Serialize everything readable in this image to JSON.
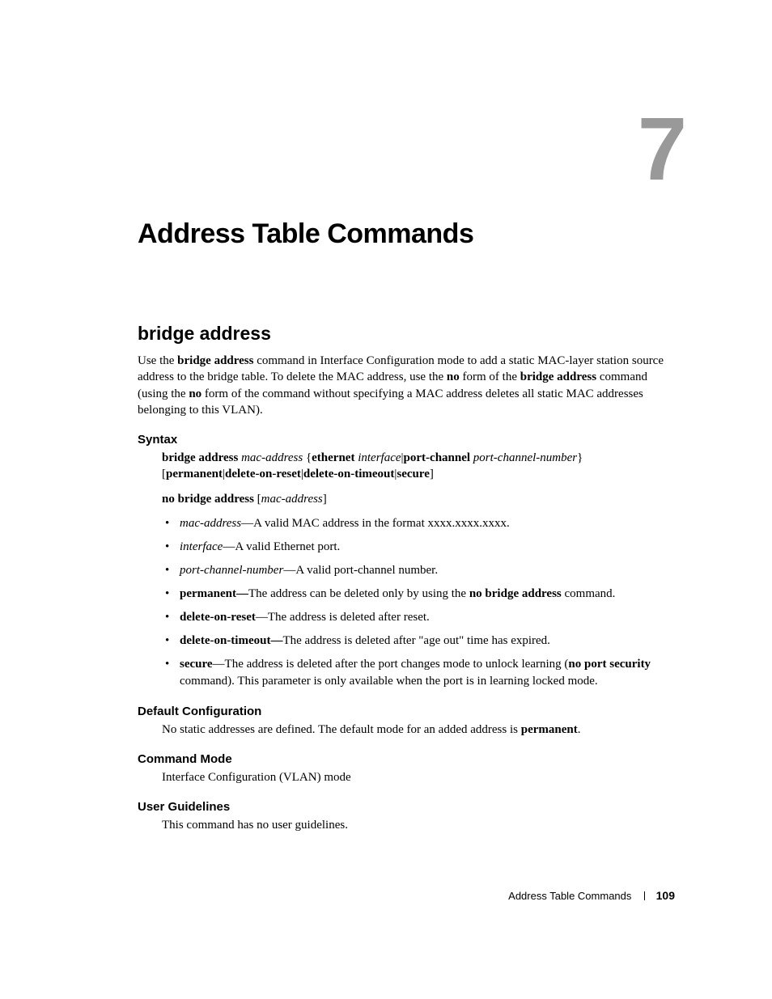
{
  "chapter": {
    "number": "7",
    "title": "Address Table Commands"
  },
  "section": {
    "title": "bridge address",
    "intro_parts": [
      "Use the ",
      "bridge address",
      " command in Interface Configuration mode to add a static MAC-layer station source address to the bridge table. To delete the MAC address, use the ",
      "no",
      " form of the ",
      "bridge address",
      " command (using the ",
      "no",
      " form of the command without specifying a MAC address deletes all static MAC addresses belonging to this VLAN)."
    ]
  },
  "syntax": {
    "heading": "Syntax",
    "line1": {
      "p1": "bridge address ",
      "p2": "mac-address",
      "p3": " {",
      "p4": "ethernet ",
      "p5": "interface",
      "p6": "|",
      "p7": "port-channel ",
      "p8": "port-channel-number",
      "p9": "} [",
      "p10": "permanent",
      "p11": "|",
      "p12": "delete-on-reset",
      "p13": "|",
      "p14": "delete-on-timeout",
      "p15": "|",
      "p16": "secure",
      "p17": "]"
    },
    "line2": {
      "p1": "no bridge address",
      "p2": " [",
      "p3": "mac-address",
      "p4": "]"
    },
    "params": [
      {
        "name": "mac-address",
        "desc": "—A valid MAC address in the format xxxx.xxxx.xxxx.",
        "name_italic": true
      },
      {
        "name": "interface",
        "desc": "—A valid Ethernet port.",
        "name_italic": true
      },
      {
        "name": "port-channel-number",
        "desc": "—A valid port-channel number.",
        "name_italic": true
      },
      {
        "name": "permanent—",
        "desc_pre": "The address can be deleted only by using the ",
        "desc_bold": "no bridge address",
        "desc_post": " command.",
        "name_bold": true
      },
      {
        "name": "delete-on-reset",
        "desc": "—The address is deleted after reset.",
        "name_bold": true
      },
      {
        "name": "delete-on-timeout—",
        "desc": "The address is deleted after \"age out\" time has expired.",
        "name_bold": true
      },
      {
        "name": "secure",
        "desc_pre": "—The address is deleted after the port changes mode to unlock learning (",
        "desc_bold": "no port security",
        "desc_post": " command). This parameter is only available when the port is in learning locked mode.",
        "name_bold": true
      }
    ]
  },
  "default_config": {
    "heading": "Default Configuration",
    "text_pre": "No static addresses are defined. The default mode for an added address is ",
    "text_bold": "permanent",
    "text_post": "."
  },
  "command_mode": {
    "heading": "Command Mode",
    "text": "Interface Configuration (VLAN) mode"
  },
  "user_guidelines": {
    "heading": "User Guidelines",
    "text": "This command has no user guidelines."
  },
  "footer": {
    "label": "Address Table Commands",
    "page": "109"
  }
}
